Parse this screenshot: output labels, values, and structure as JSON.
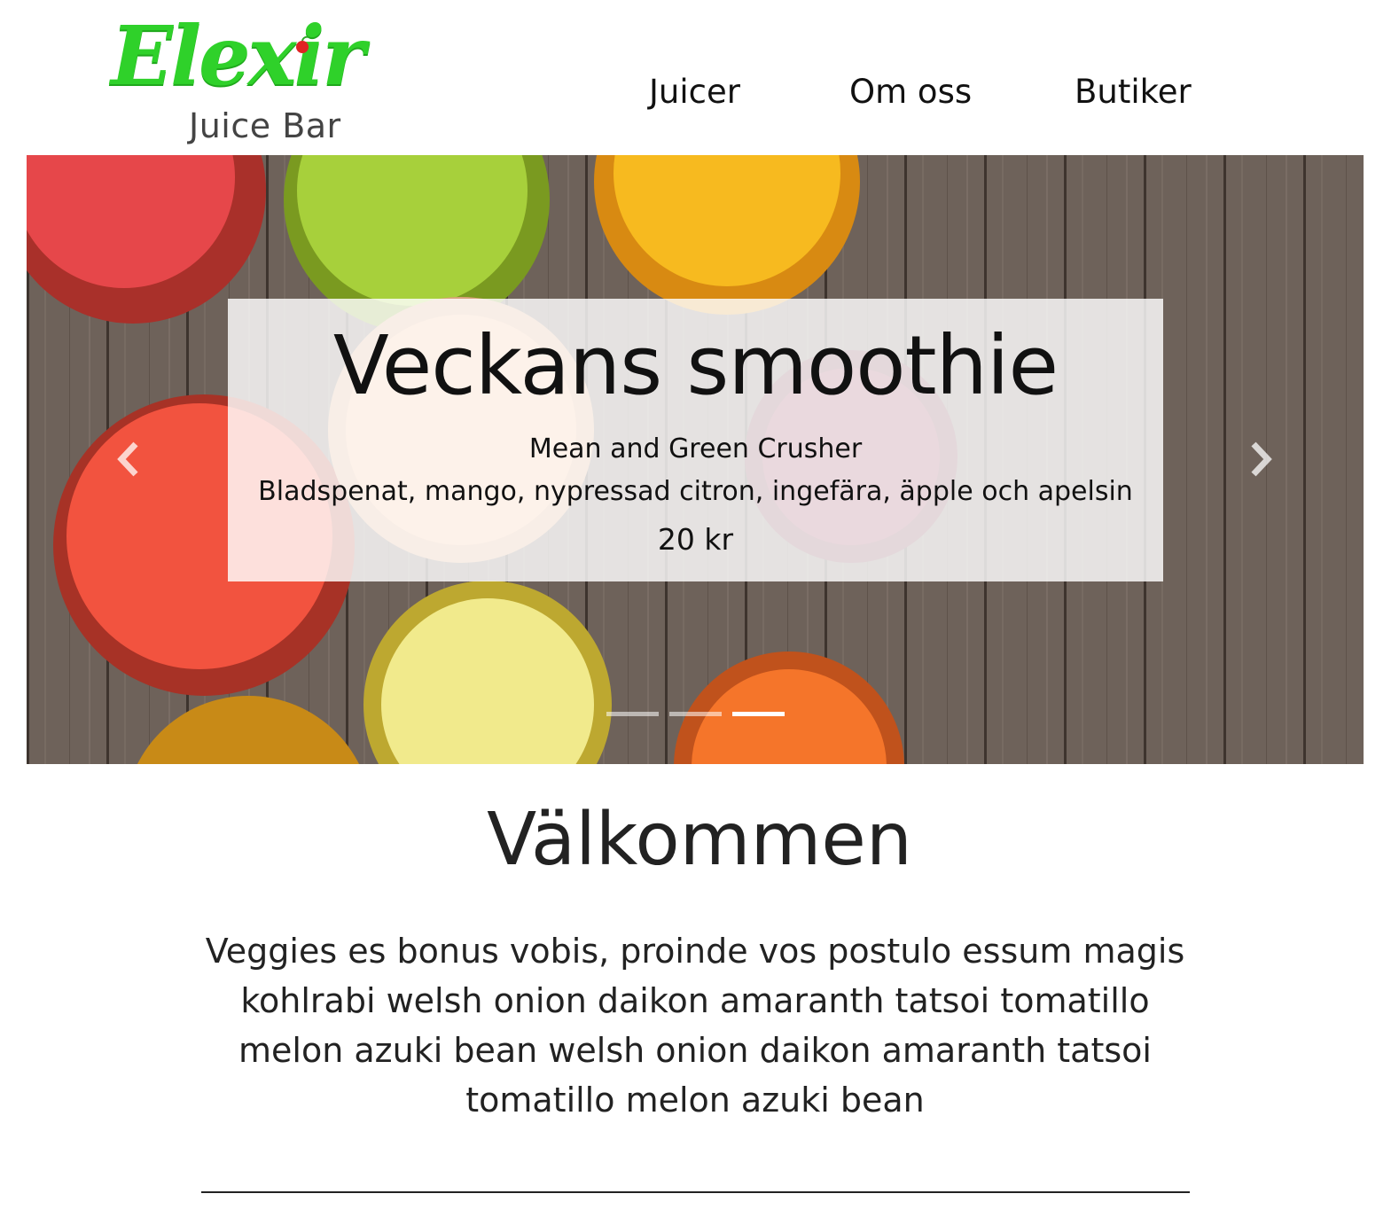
{
  "brand": {
    "name": "Elexir",
    "tagline": "Juice Bar"
  },
  "nav": {
    "items": [
      {
        "label": "Juicer"
      },
      {
        "label": "Om oss"
      },
      {
        "label": "Butiker"
      }
    ]
  },
  "carousel": {
    "caption": {
      "title": "Veckans smoothie",
      "name": "Mean and Green Crusher",
      "ingredients": "Bladspenat, mango, nypressad citron, ingefära, äpple och apelsin",
      "price": "20 kr"
    },
    "slide_count": 3,
    "active_slide": 3
  },
  "welcome": {
    "title": "Välkommen",
    "text": "Veggies es bonus vobis, proinde vos postulo essum magis kohlrabi welsh onion daikon amaranth tatsoi tomatillo melon azuki bean welsh onion daikon amaranth tatsoi tomatillo melon azuki bean"
  },
  "colors": {
    "brand_green": "#2fd12a",
    "text": "#222222",
    "background": "#ffffff"
  }
}
